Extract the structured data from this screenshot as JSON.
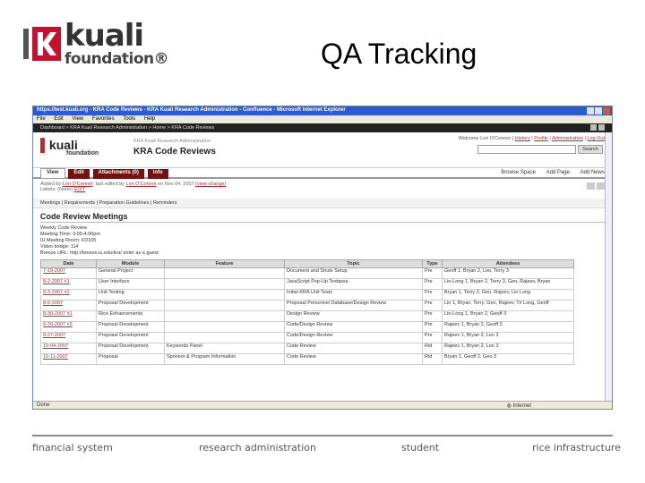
{
  "slide": {
    "logo_word": "kuali",
    "logo_sub": "foundation®",
    "title": "QA Tracking"
  },
  "browser": {
    "window_title": "https://test.kuali.org - KRA Code Reviews - KRA Kuali Research Administration - Confluence - Microsoft Internet Explorer",
    "menu": [
      "File",
      "Edit",
      "View",
      "Favorites",
      "Tools",
      "Help"
    ],
    "status_left": "Done",
    "status_zone": "Internet"
  },
  "confluence": {
    "breadcrumb": "Dashboard > KRA Kuali Research Administration > Home > KRA Code Reviews",
    "welcome": "Welcome Lori O'Connor",
    "user_links": [
      "History",
      "Profile",
      "Administration",
      "Log Out"
    ],
    "search_label": "Search",
    "mini_logo": "kuali",
    "mini_sub": "foundation",
    "space_name": "KRA Kuali Research Administration",
    "page_name": "KRA Code Reviews",
    "tabs": [
      "View",
      "Edit",
      "Attachments (0)",
      "Info"
    ],
    "actions": [
      "Browse Space",
      "Add Page",
      "Add News"
    ],
    "meta_added": "Added by",
    "meta_added_user": "Lori O'Connor",
    "meta_edited": ", last edited by",
    "meta_edited_user": "Lori O'Connor",
    "meta_date": "on Nov 04, 2007",
    "meta_view_change": "(view change)",
    "meta_labels": "Labels: (None)",
    "meta_edit": "EDIT",
    "links": "Meetings | Requirements | Preparation Guidelines | Reminders"
  },
  "meetings": {
    "heading": "Code Review Meetings",
    "info": [
      "Weekly Code Review",
      "Meeting Time: 3:00-4:00pm",
      "IU Meeting Room: FD105",
      "Video bridge: 114",
      "Breeze URL: http://breeze.iu.edu/kra/ enter as a guest"
    ],
    "columns": [
      "Date",
      "Module",
      "Feature",
      "Topic",
      "Type",
      "Attendees"
    ],
    "rows": [
      {
        "date": "7-19-2007",
        "module": "General Project",
        "feature": "",
        "topic": "Document and Struts Setup",
        "type": "Pre",
        "attendees": "Geoff 1, Bryan 2, Leo, Terry 3"
      },
      {
        "date": "8-2-2007 #1",
        "module": "User Interface",
        "feature": "",
        "topic": "JavaScript Pop-Up Textarea",
        "type": "Pre",
        "attendees": "Lin-Long 1, Bryan 2, Terry 3, Geo, Rajeev, Bryan"
      },
      {
        "date": "9-3-2007 #2",
        "module": "Unit Testing",
        "feature": "",
        "topic": "Initial KRA Unit Tests",
        "type": "Pre",
        "attendees": "Bryan 1, Terry 2, Geo, Rajeev, Lin Long"
      },
      {
        "date": "8-9-2007",
        "module": "Proposal Development",
        "feature": "",
        "topic": "Proposal Personnel Database/Design Review",
        "type": "Pre",
        "attendees": "Lin 1, Bryan, Terry, Geo, Rajeev, Tri Long, Geoff"
      },
      {
        "date": "8-30-2007 #1",
        "module": "Rice Enhancements",
        "feature": "",
        "topic": "Design Review",
        "type": "Pre",
        "attendees": "Lin-Long 1, Bryan 2, Geoff 3"
      },
      {
        "date": "9-20-2007 #2",
        "module": "Proposal Development",
        "feature": "",
        "topic": "Code/Design Review",
        "type": "Pre",
        "attendees": "Rajeev 1, Bryan 2, Geoff 3"
      },
      {
        "date": "9-27-2007",
        "module": "Proposal Development",
        "feature": "",
        "topic": "Code/Design Review",
        "type": "Pre",
        "attendees": "Rajeev 1, Bryan 2, Leo 3"
      },
      {
        "date": "10-04-2007",
        "module": "Proposal Development",
        "feature": "Keywords Panel",
        "topic": "Code Review",
        "type": "Rid",
        "attendees": "Rajeev 1, Bryan 2, Leo 3"
      },
      {
        "date": "10-11-2007",
        "module": "Proposal",
        "feature": "Sponsor & Program Information",
        "topic": "Code Review",
        "type": "Rid",
        "attendees": "Bryan 1, Geoff 2, Geo 3"
      }
    ]
  },
  "footer": {
    "items": [
      "financial system",
      "research administration",
      "student",
      "rice infrastructure"
    ]
  },
  "colors": {
    "kuali_red": "#c8102e",
    "tab_maroon": "#7a0f0f",
    "link_red": "#aa3333",
    "ie_titlebar": "#2a5bd0"
  }
}
